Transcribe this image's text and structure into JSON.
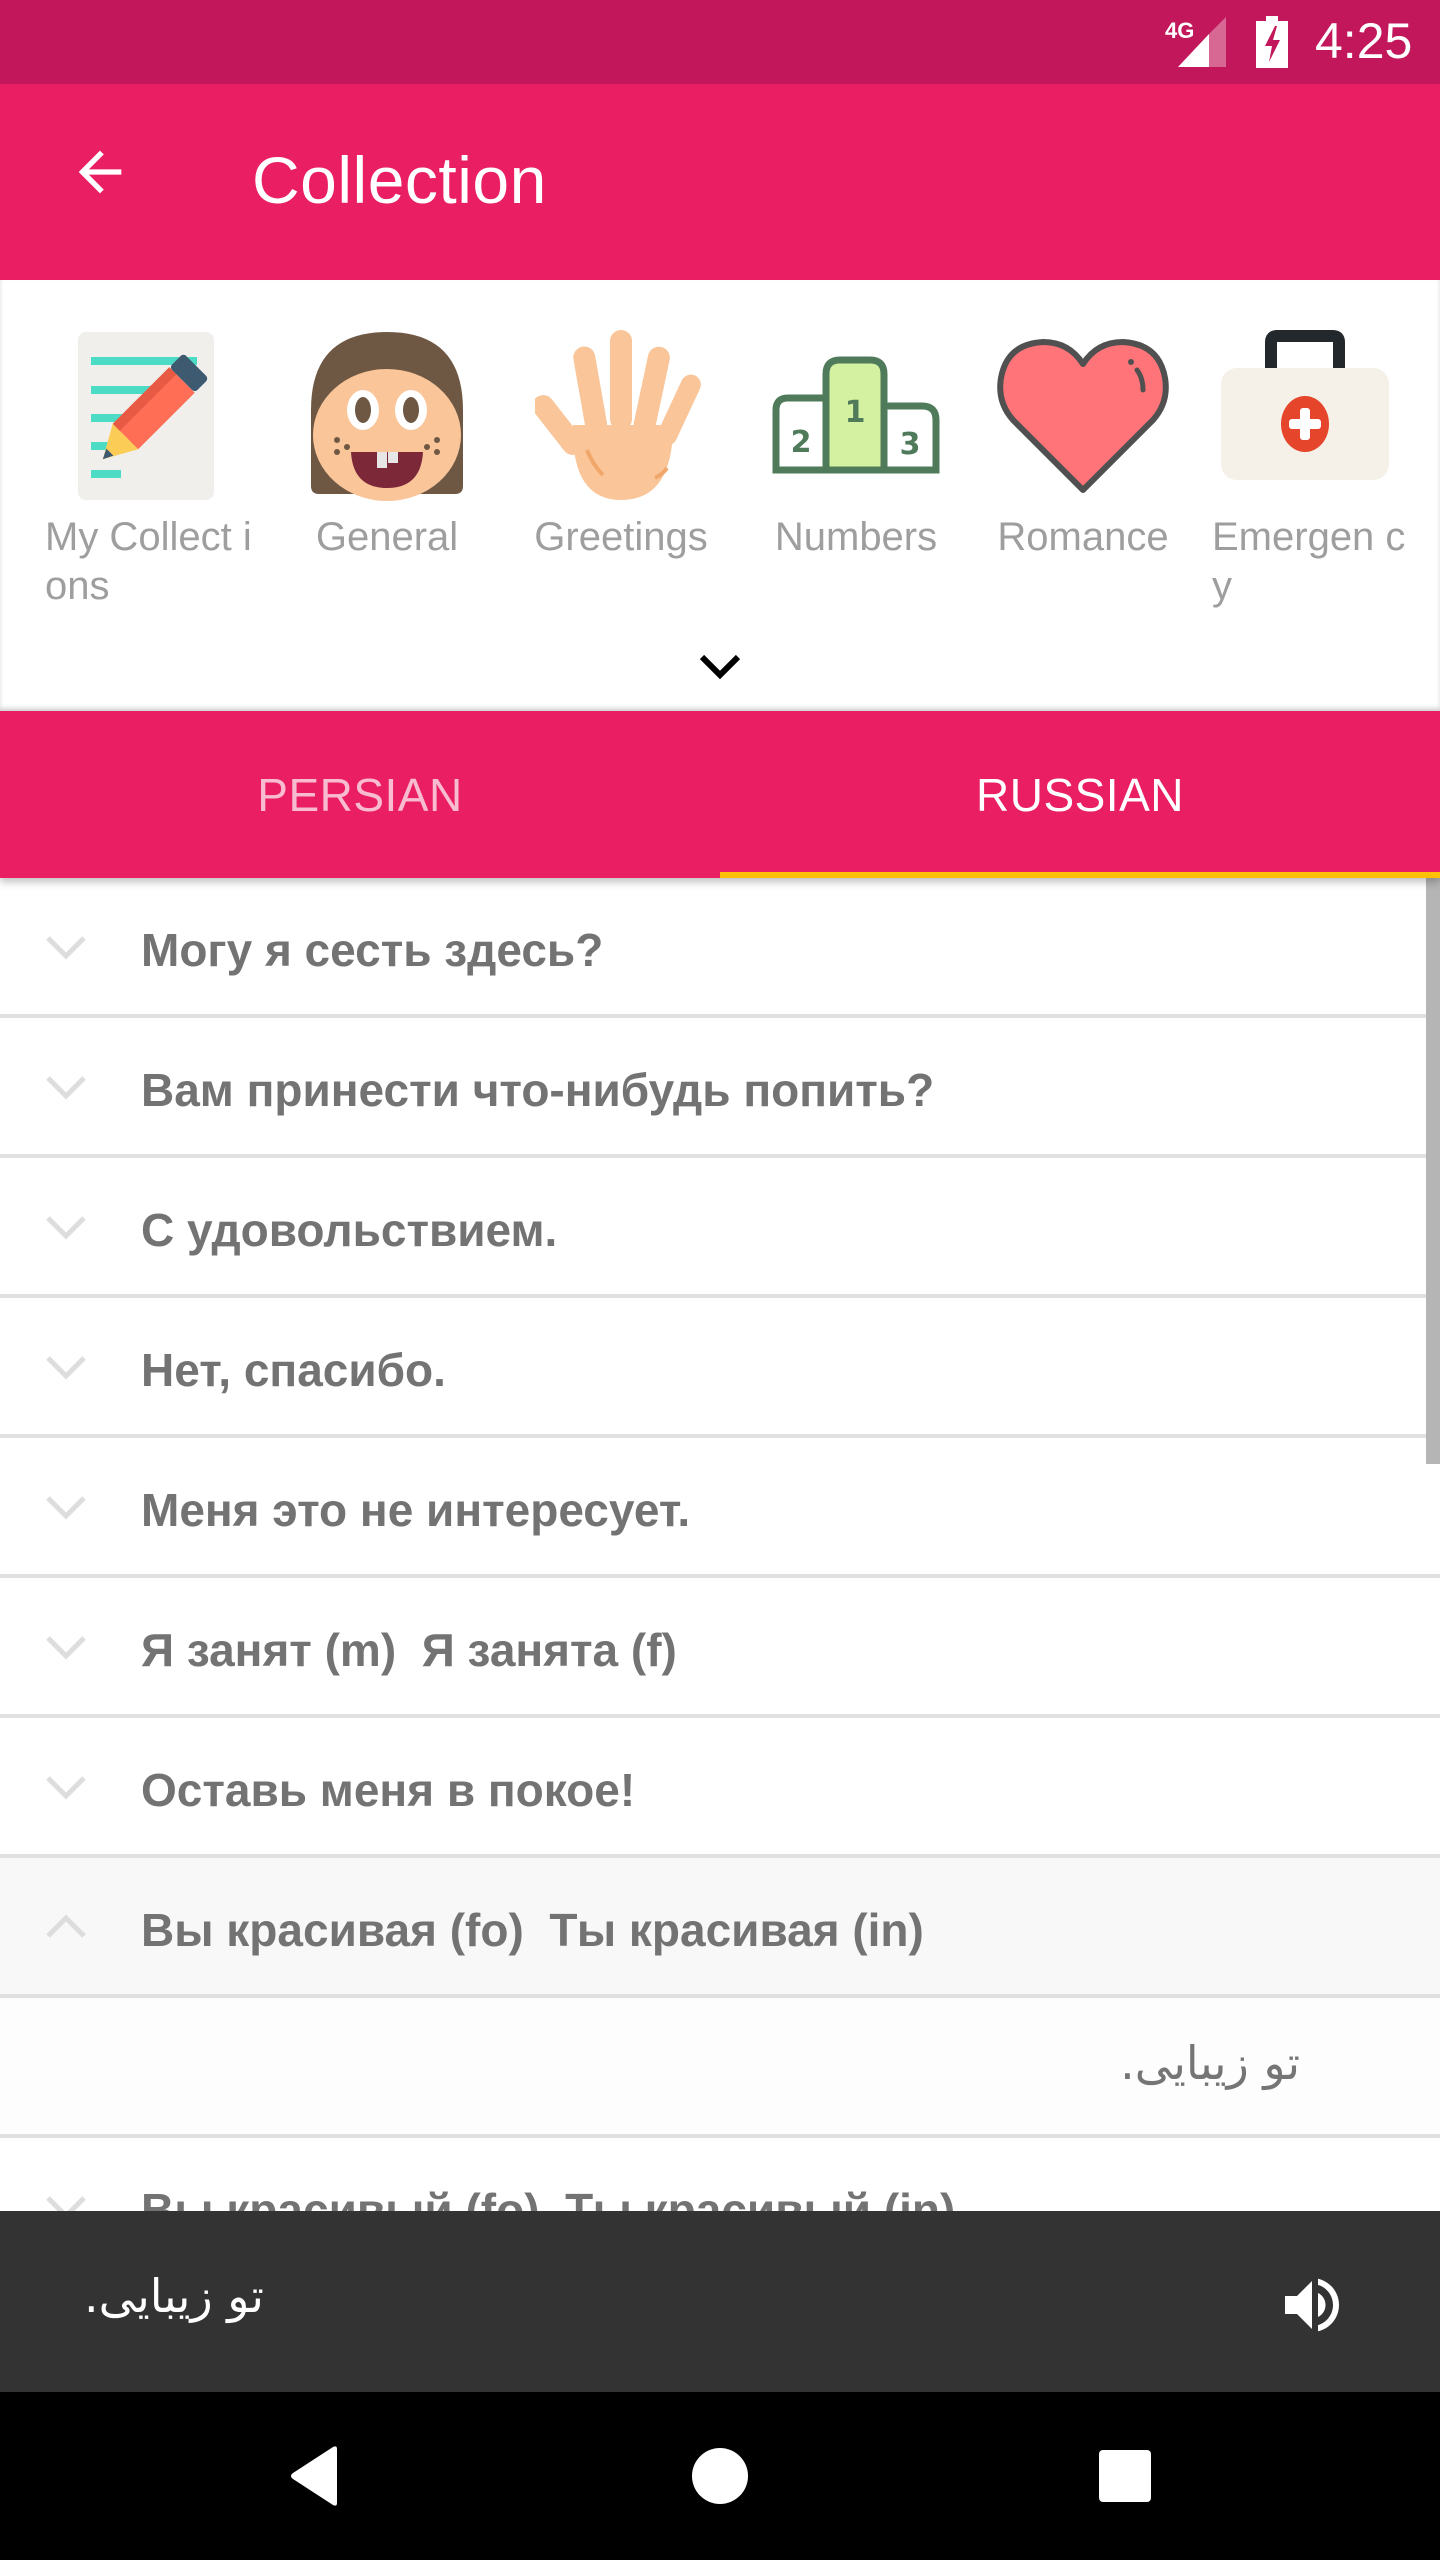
{
  "status_bar": {
    "network": "4G",
    "time": "4:25",
    "signal_icon": "signal-icon",
    "battery_icon": "battery-charging-icon"
  },
  "app_bar": {
    "title": "Collection",
    "back_icon": "arrow-back-icon"
  },
  "categories": {
    "items": [
      {
        "label": "My Collections",
        "display": "My Collect ions",
        "icon": "notepad-pencil-icon"
      },
      {
        "label": "General",
        "display": "General",
        "icon": "face-icon"
      },
      {
        "label": "Greetings",
        "display": "Greetings",
        "icon": "waving-hand-icon"
      },
      {
        "label": "Numbers",
        "display": "Numbers",
        "icon": "podium-icon"
      },
      {
        "label": "Romance",
        "display": "Romance",
        "icon": "heart-icon"
      },
      {
        "label": "Emergency",
        "display": "Emergen cy",
        "icon": "first-aid-kit-icon"
      }
    ],
    "expand_icon": "chevron-down-icon"
  },
  "tabs": [
    {
      "label": "PERSIAN",
      "active": false
    },
    {
      "label": "RUSSIAN",
      "active": true
    }
  ],
  "colors": {
    "primary": "#e91e63",
    "primary_dark": "#c2185b",
    "accent": "#ffc107",
    "text": "#737373",
    "player_bg": "#333333"
  },
  "phrases": [
    {
      "text": "Могу я сесть здесь?",
      "expanded": false
    },
    {
      "text": "Вам принести что-нибудь попить?",
      "expanded": false
    },
    {
      "text": "С удовольствием.",
      "expanded": false
    },
    {
      "text": "Нет, спасибо.",
      "expanded": false
    },
    {
      "text": "Меня это не интересует.",
      "expanded": false
    },
    {
      "text": "Я занят (m)  Я занята (f)",
      "expanded": false
    },
    {
      "text": "Оставь меня в покое!",
      "expanded": false
    },
    {
      "text": "Вы красивая (fo)  Ты красивая (in)",
      "expanded": true,
      "translation": "تو زیبایی."
    },
    {
      "text": "Вы красивый (fo)  Ты красивый (in)",
      "expanded": false
    }
  ],
  "player": {
    "text": "تو زیبایی.",
    "icon": "volume-up-icon"
  },
  "nav_bar": {
    "back": "nav-back-icon",
    "home": "nav-home-icon",
    "recents": "nav-recents-icon"
  }
}
